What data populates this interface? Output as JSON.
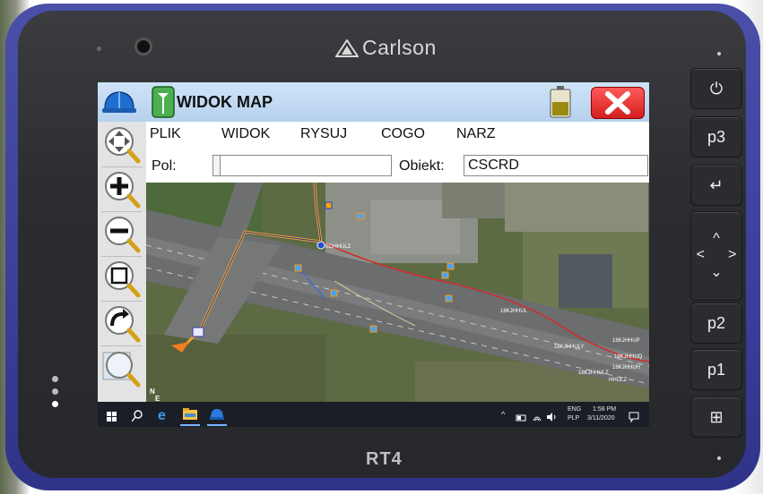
{
  "device": {
    "brand": "Carlson",
    "model": "RT4",
    "buttons": {
      "power": "⏻",
      "p3": "p3",
      "enter": "↵",
      "up": "^",
      "left": "<",
      "right": ">",
      "down": "⌄",
      "p2": "p2",
      "p1": "p1",
      "windows": "⊞"
    }
  },
  "app": {
    "title": "WIDOK MAP",
    "icons": [
      "hardhat-icon",
      "survey-pole-icon",
      "battery-icon",
      "close-icon"
    ],
    "menu": [
      "PLIK",
      "WIDOK",
      "RYSUJ",
      "COGO",
      "NARZ"
    ],
    "fields": {
      "pol_label": "Pol:",
      "pol_value": "",
      "obiekt_label": "Obiekt:",
      "obiekt_value": "CSCRD"
    },
    "tools": [
      "pan-icon",
      "zoom-in-icon",
      "zoom-out-icon",
      "zoom-window-icon",
      "zoom-previous-icon",
      "zoom-extents-icon"
    ],
    "map": {
      "compass": "N\nE",
      "labels": [
        "EDHHULZ",
        "18KJHHUL",
        "18KJHHULY",
        "18KJHHUP",
        "18KJHHUQ",
        "18KJHHULZ",
        "18KJHHUH",
        "HHULZ"
      ]
    },
    "colors": {
      "titlebar": "#b6d1ee",
      "road_line": "#d42a2a",
      "path_line": "#f0a030",
      "close_button": "#e02b2b"
    }
  },
  "taskbar": {
    "lang_top": "ENG",
    "lang_bottom": "PLP",
    "time": "1:58 PM",
    "date": "3/11/2020"
  }
}
